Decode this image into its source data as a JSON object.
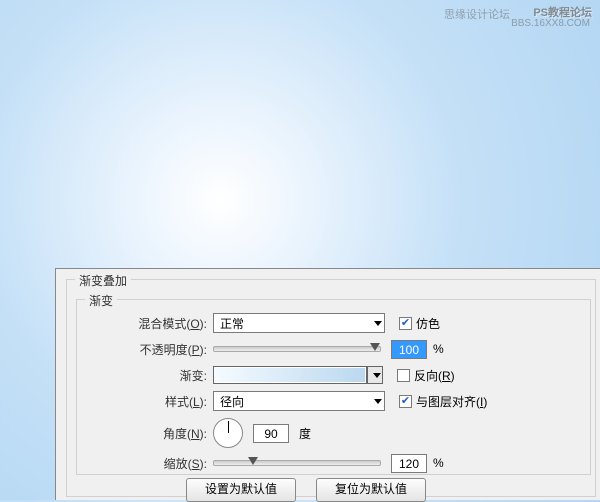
{
  "watermark": {
    "text1": "思缘设计论坛",
    "text2": "PS教程论坛",
    "text3": "BBS.16XX8.COM"
  },
  "outer": {
    "title": "渐变叠加"
  },
  "inner": {
    "title": "渐变"
  },
  "blend": {
    "label": "混合模式(O):",
    "value": "正常",
    "dither": "仿色"
  },
  "opacity": {
    "label": "不透明度(P):",
    "value": "100",
    "unit": "%"
  },
  "gradient": {
    "label": "渐变:",
    "reverse": "反向(R)"
  },
  "style": {
    "label": "样式(L):",
    "value": "径向",
    "align": "与图层对齐(I)"
  },
  "angle": {
    "label": "角度(N):",
    "value": "90",
    "unit": "度"
  },
  "scale": {
    "label": "缩放(S):",
    "value": "120",
    "unit": "%"
  },
  "buttons": {
    "default": "设置为默认值",
    "reset": "复位为默认值"
  }
}
